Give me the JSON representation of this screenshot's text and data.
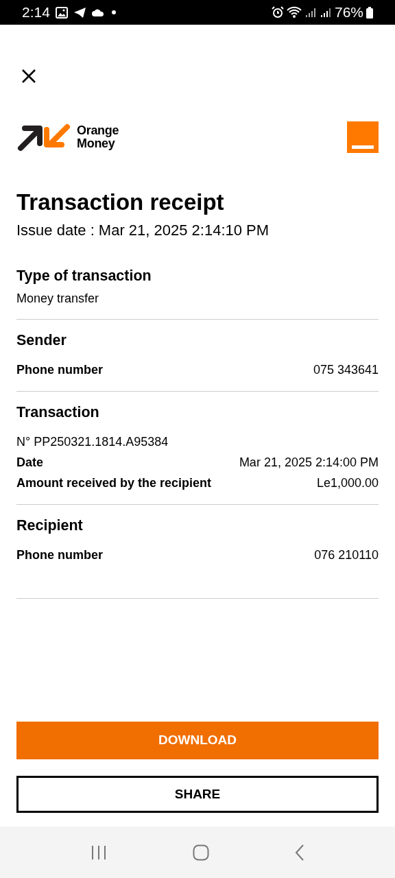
{
  "status_bar": {
    "time": "2:14",
    "battery": "76%"
  },
  "brand": {
    "lines": [
      "Orange",
      "Money"
    ]
  },
  "receipt": {
    "title": "Transaction receipt",
    "issue_date": "Issue date : Mar 21, 2025 2:14:10 PM"
  },
  "sections": [
    {
      "kind": "simple",
      "title": "Type of transaction",
      "value": "Money transfer"
    },
    {
      "kind": "details",
      "title": "Sender",
      "rows": [
        {
          "label": "Phone number",
          "value": "075 343641"
        }
      ]
    },
    {
      "kind": "details",
      "title": "Transaction",
      "reference": "N° PP250321.1814.A95384",
      "rows": [
        {
          "label": "Date",
          "value": "Mar 21, 2025 2:14:00 PM"
        },
        {
          "label": "Amount received by the recipient",
          "value": "Le1,000.00"
        }
      ]
    },
    {
      "kind": "details",
      "title": "Recipient",
      "rows": [
        {
          "label": "Phone number",
          "value": "076 210110"
        }
      ]
    }
  ],
  "buttons": [
    {
      "label": "DOWNLOAD",
      "kind": "primary"
    },
    {
      "label": "SHARE",
      "kind": "outline"
    }
  ]
}
